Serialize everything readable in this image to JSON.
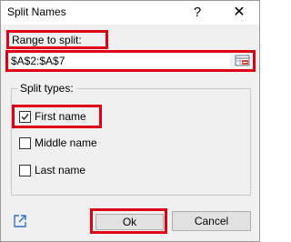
{
  "window": {
    "title": "Split Names",
    "help_label": "?",
    "close_label": "✕"
  },
  "range": {
    "label": "Range to split:",
    "value": "$A$2:$A$7",
    "picker_icon": "range-picker-icon"
  },
  "split_types": {
    "label": "Split types:",
    "options": [
      {
        "label": "First name",
        "checked": true
      },
      {
        "label": "Middle name",
        "checked": false
      },
      {
        "label": "Last name",
        "checked": false
      }
    ]
  },
  "footer": {
    "link_icon": "external-link-icon",
    "ok_label": "Ok",
    "cancel_label": "Cancel"
  },
  "colors": {
    "highlight": "#e00016",
    "link_icon": "#2b73c9",
    "dialog_bg": "#f0f0f0"
  }
}
